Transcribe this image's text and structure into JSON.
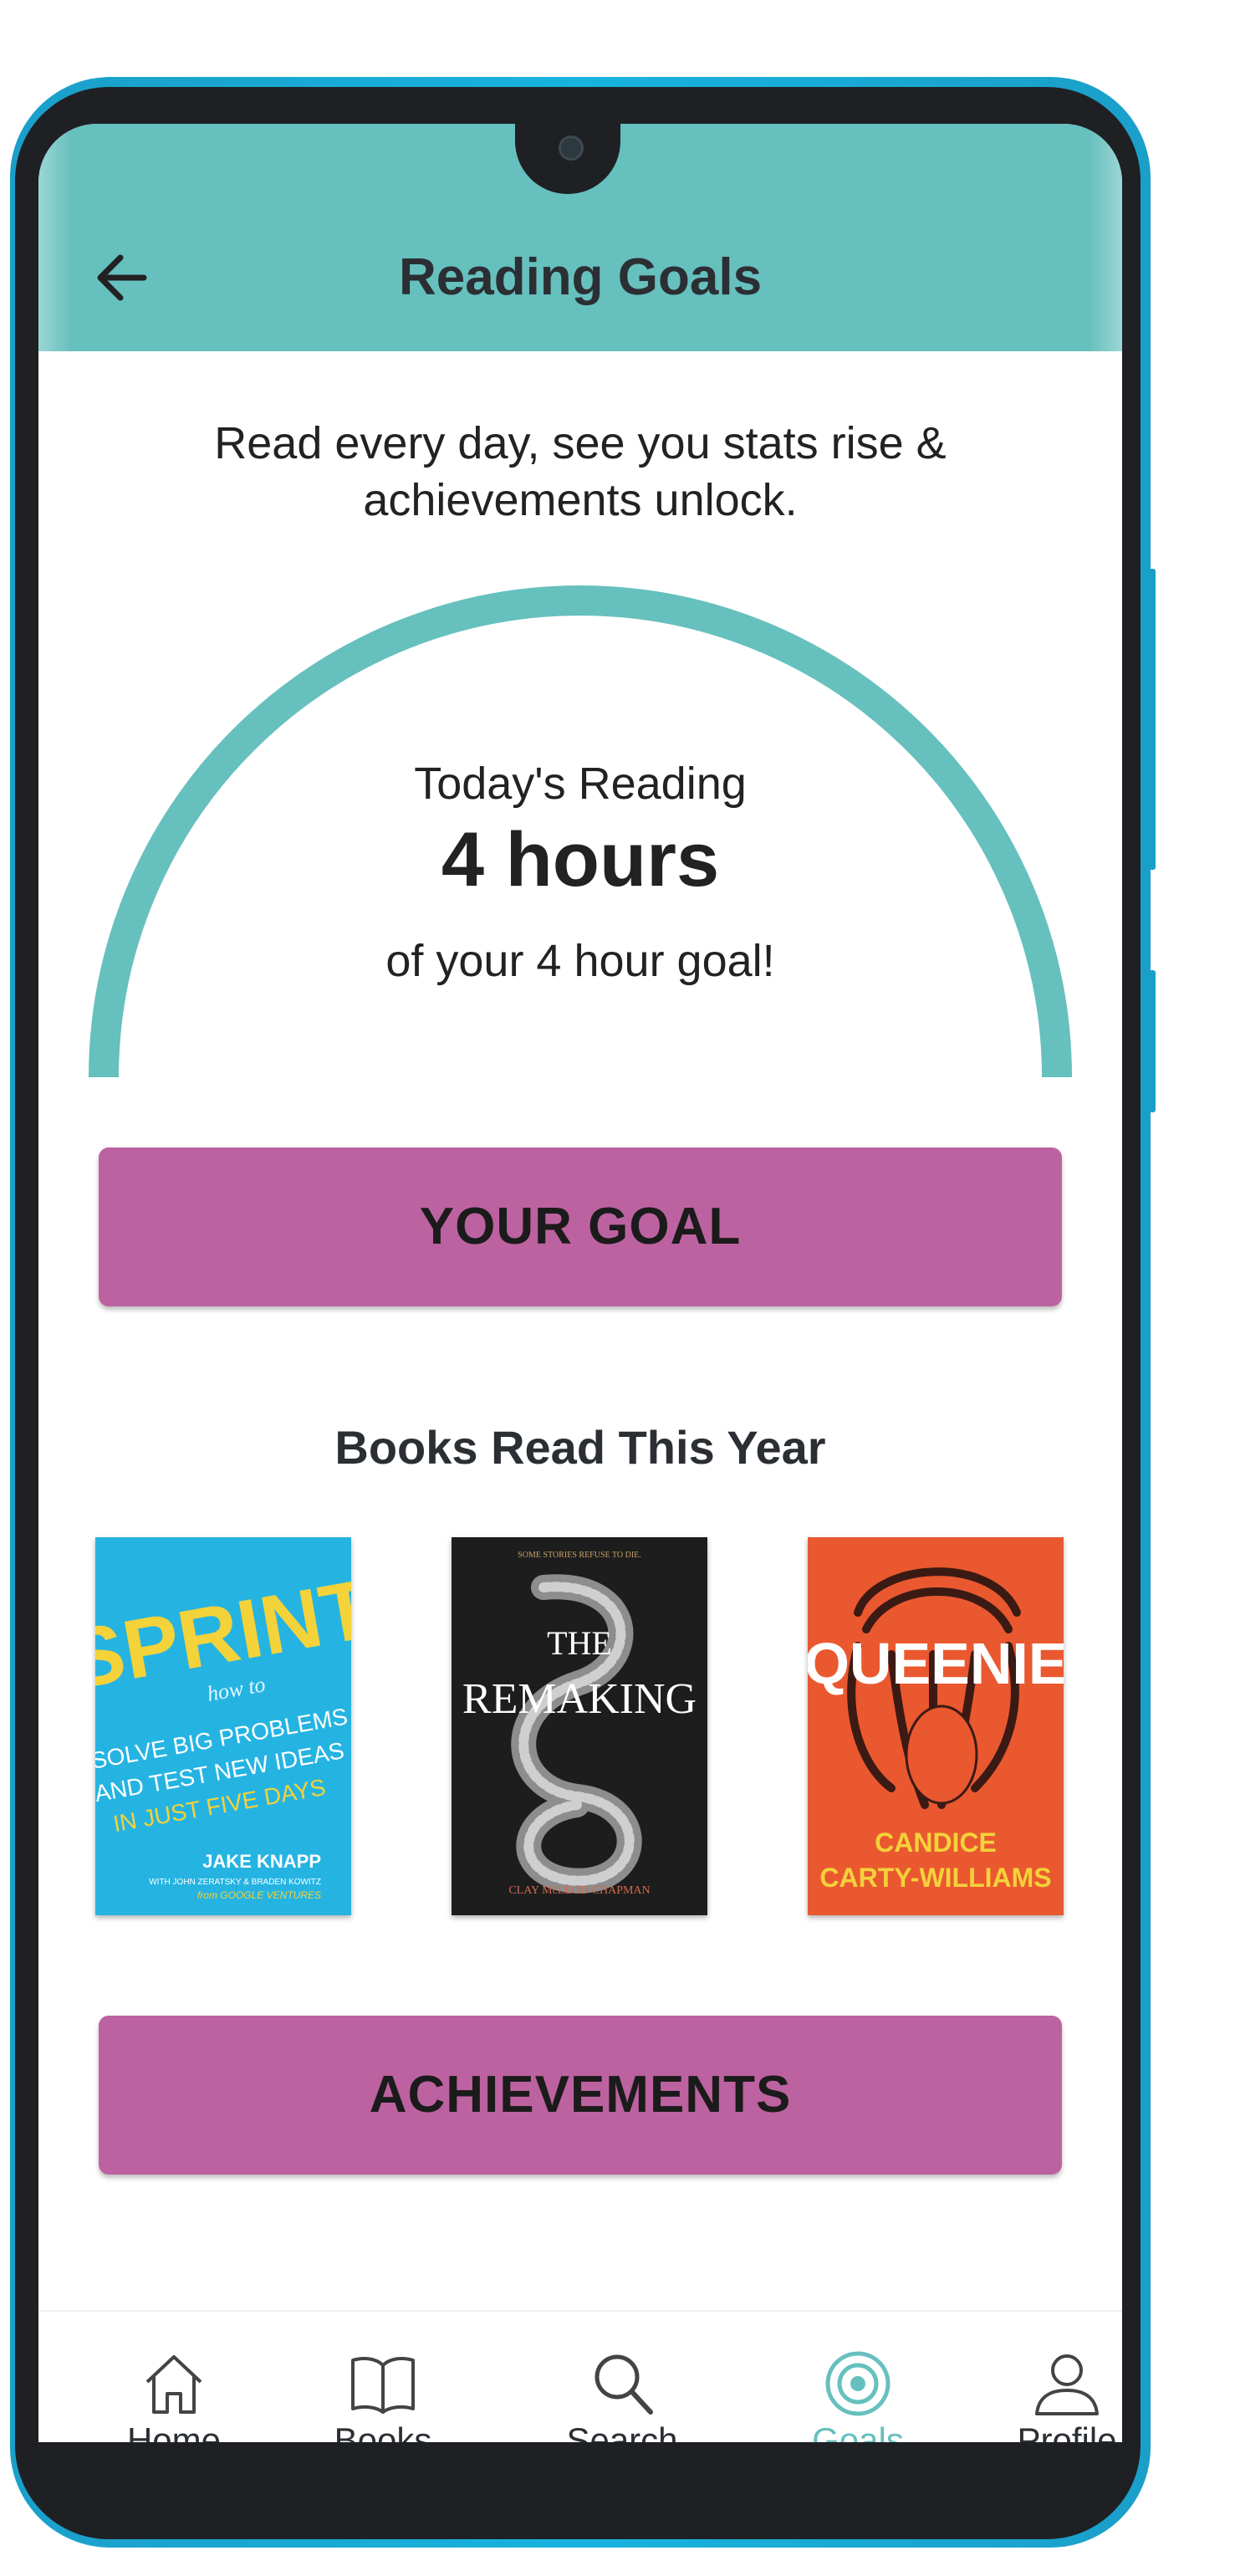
{
  "app_bar": {
    "title": "Reading Goals",
    "back_icon": "arrow-left-icon",
    "color": "#66c0be"
  },
  "intro": {
    "text": "Read every day, see you stats rise & achievements unlock."
  },
  "progress": {
    "label": "Today's Reading",
    "value": "4 hours",
    "goal_text": "of your 4 hour goal!",
    "fraction": 1.0,
    "color": "#66c0be"
  },
  "buttons": {
    "your_goal": "YOUR GOAL",
    "achievements": "ACHIEVEMENTS",
    "color": "#bd62a0"
  },
  "books_section": {
    "title": "Books Read This Year",
    "books": [
      {
        "title_big": "SPRINT",
        "subtitle_how": "how to",
        "lines": [
          "SOLVE BIG PROBLEMS",
          "AND TEST NEW IDEAS",
          "IN JUST FIVE DAYS"
        ],
        "author": "JAKE KNAPP",
        "coauthors": "WITH JOHN ZERATSKY & BRADEN KOWITZ",
        "publisher": "from GOOGLE VENTURES"
      },
      {
        "tagline": "SOME STORIES REFUSE TO DIE.",
        "title_top": "THE",
        "title_main": "REMAKING",
        "author": "CLAY McLEOD CHAPMAN"
      },
      {
        "title_main": "QUEENIE",
        "author_line1": "CANDICE",
        "author_line2": "CARTY-WILLIAMS"
      }
    ]
  },
  "bottom_nav": {
    "items": [
      {
        "label": "Home",
        "icon": "home-icon",
        "active": false
      },
      {
        "label": "Books",
        "icon": "book-icon",
        "active": false
      },
      {
        "label": "Search",
        "icon": "search-icon",
        "active": false
      },
      {
        "label": "Goals",
        "icon": "target-icon",
        "active": true
      },
      {
        "label": "Profile",
        "icon": "profile-icon",
        "active": false
      }
    ],
    "active_color": "#66c0be"
  }
}
